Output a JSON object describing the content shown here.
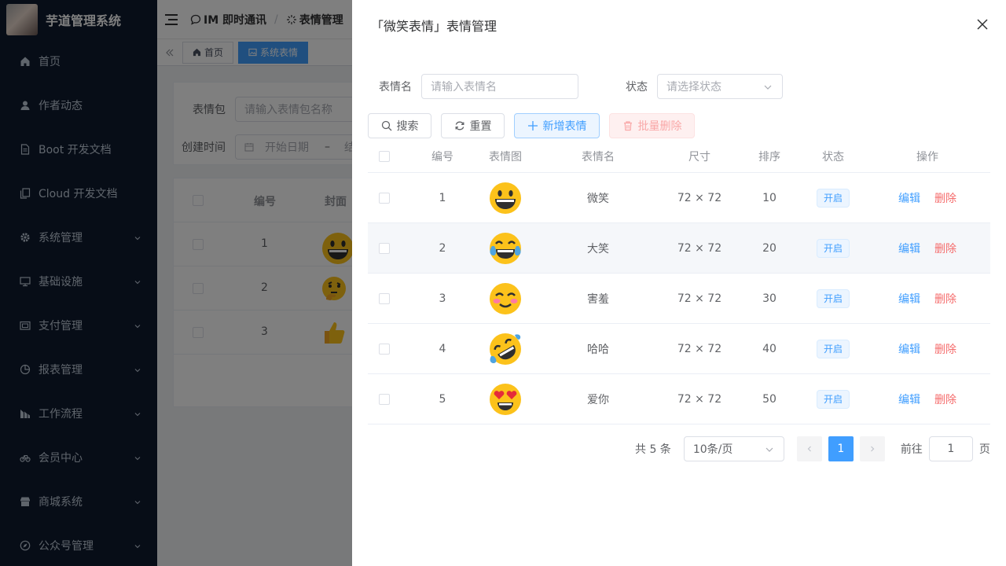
{
  "app": {
    "title": "芋道管理系统"
  },
  "sidebar": {
    "items": [
      {
        "label": "首页",
        "icon": "home-icon"
      },
      {
        "label": "作者动态",
        "icon": "user-icon"
      },
      {
        "label": "Boot 开发文档",
        "icon": "document-icon"
      },
      {
        "label": "Cloud 开发文档",
        "icon": "copy-document-icon"
      },
      {
        "label": "系统管理",
        "icon": "gear-icon"
      },
      {
        "label": "基础设施",
        "icon": "monitor-icon"
      },
      {
        "label": "支付管理",
        "icon": "wallet-icon"
      },
      {
        "label": "报表管理",
        "icon": "pie-chart-icon"
      },
      {
        "label": "工作流程",
        "icon": "workflow-icon"
      },
      {
        "label": "会员中心",
        "icon": "bicycle-icon"
      },
      {
        "label": "商城系统",
        "icon": "shop-icon"
      },
      {
        "label": "公众号管理",
        "icon": "compass-icon"
      }
    ]
  },
  "navbar": {
    "breadcrumb": [
      "IM 即时通讯",
      "表情管理"
    ]
  },
  "tags": [
    "首页",
    "系统表情"
  ],
  "bg": {
    "form": {
      "pack_label": "表情包",
      "pack_placeholder": "请输入表情包名称",
      "created_label": "创建时间",
      "start_placeholder": "开始日期",
      "dash": "–",
      "end_partial": "结"
    },
    "table": {
      "headers": [
        "编号",
        "封面"
      ],
      "rows": [
        {
          "id": "1",
          "emoji": "grinning"
        },
        {
          "id": "2",
          "emoji": "thinking"
        },
        {
          "id": "3",
          "emoji": "thumbs-up"
        }
      ]
    }
  },
  "drawer": {
    "title": "「微笑表情」表情管理",
    "form": {
      "name_label": "表情名",
      "name_placeholder": "请输入表情名",
      "status_label": "状态",
      "status_placeholder": "请选择状态"
    },
    "buttons": {
      "search": "搜索",
      "reset": "重置",
      "add": "新增表情",
      "batch_delete": "批量删除"
    },
    "table": {
      "headers": [
        "编号",
        "表情图",
        "表情名",
        "尺寸",
        "排序",
        "状态",
        "操作"
      ],
      "rows": [
        {
          "id": "1",
          "emoji": "grinning",
          "name": "微笑",
          "size": "72 × 72",
          "sort": "10",
          "status": "开启",
          "edit": "编辑",
          "delete": "删除"
        },
        {
          "id": "2",
          "emoji": "joy",
          "name": "大笑",
          "size": "72 × 72",
          "sort": "20",
          "status": "开启",
          "edit": "编辑",
          "delete": "删除"
        },
        {
          "id": "3",
          "emoji": "blush",
          "name": "害羞",
          "size": "72 × 72",
          "sort": "30",
          "status": "开启",
          "edit": "编辑",
          "delete": "删除"
        },
        {
          "id": "4",
          "emoji": "rofl",
          "name": "哈哈",
          "size": "72 × 72",
          "sort": "40",
          "status": "开启",
          "edit": "编辑",
          "delete": "删除"
        },
        {
          "id": "5",
          "emoji": "heart-eyes",
          "name": "爱你",
          "size": "72 × 72",
          "sort": "50",
          "status": "开启",
          "edit": "编辑",
          "delete": "删除"
        }
      ]
    },
    "pagination": {
      "total": "共 5 条",
      "page_size": "10条/页",
      "current": "1",
      "goto_label": "前往",
      "goto_value": "1",
      "page_suffix": "页"
    }
  },
  "colors": {
    "primary": "#409eff",
    "danger": "#f56c6c",
    "sidebar_bg": "#0f1a2e",
    "emoji_yellow": "#fcc21b"
  }
}
